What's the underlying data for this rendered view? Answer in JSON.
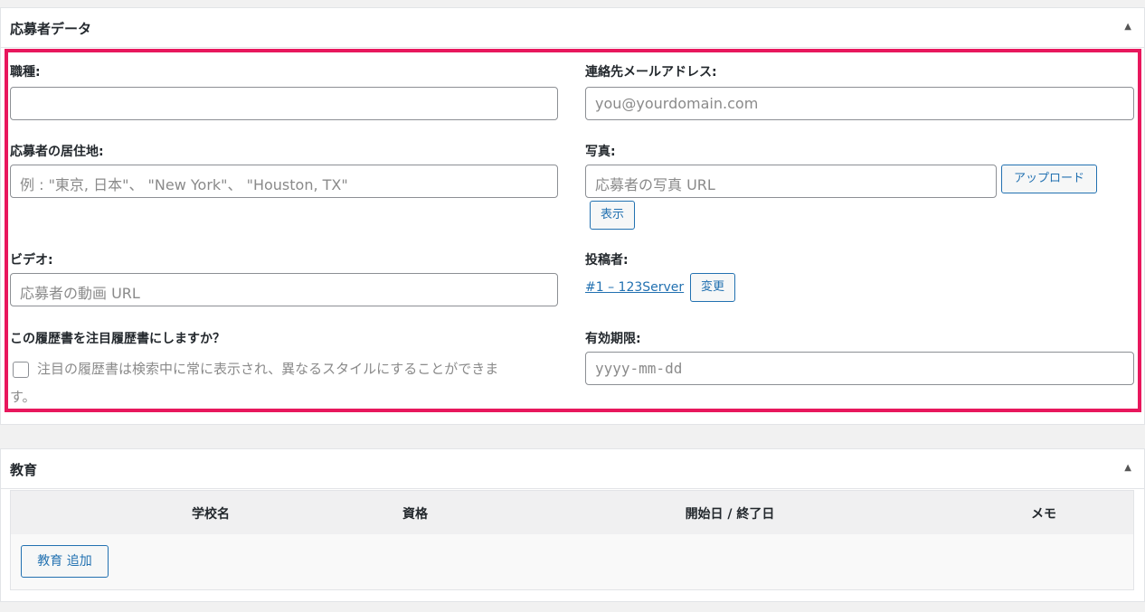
{
  "applicant_box": {
    "title": "応募者データ",
    "toggle_icon": "▲",
    "fields": {
      "job_type": {
        "label": "職種:",
        "value": ""
      },
      "contact_email": {
        "label": "連絡先メールアドレス:",
        "placeholder": "you@yourdomain.com"
      },
      "location": {
        "label": "応募者の居住地:",
        "placeholder": "例 : \"東京, 日本\"、 \"New York\"、 \"Houston, TX\""
      },
      "photo": {
        "label": "写真:",
        "placeholder": "応募者の写真 URL",
        "upload_label": "アップロード",
        "show_label": "表示"
      },
      "video": {
        "label": "ビデオ:",
        "placeholder": "応募者の動画 URL"
      },
      "author": {
        "label": "投稿者:",
        "link_text": "#1 – 123Server",
        "change_label": "変更"
      },
      "featured": {
        "label": "この履歴書を注目履歴書にしますか？",
        "checkbox_text_line1": "注目の履歴書は検索中に常に表示され、異なるスタイルにすることができま",
        "checkbox_text_line2": "す。",
        "checked": false
      },
      "expiry": {
        "label": "有効期限:",
        "placeholder": "yyyy-mm-dd"
      }
    }
  },
  "education_box": {
    "title": "教育",
    "toggle_icon": "▲",
    "columns": [
      "学校名",
      "資格",
      "開始日 / 終了日",
      "メモ"
    ],
    "add_button_label": "教育 追加"
  },
  "colors": {
    "highlight_border": "#e8175d",
    "link": "#2271b1"
  }
}
